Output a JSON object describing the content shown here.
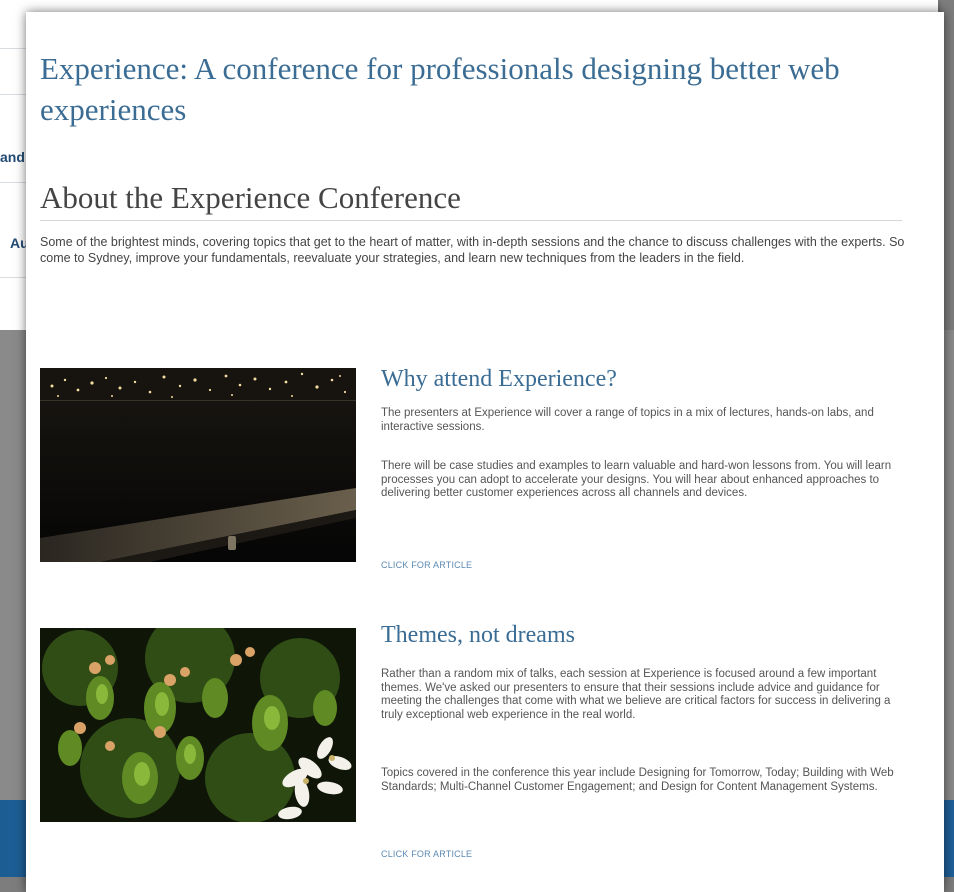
{
  "background": {
    "text_and": "and",
    "text_au": "Au"
  },
  "page": {
    "title": "Experience: A conference for professionals designing better web experiences",
    "section_title": "About the Experience Conference",
    "intro": "Some of the brightest minds, covering topics that get to the heart of matter, with in-depth sessions and the chance to discuss challenges with the experts. So come to Sydney, improve your fundamentals, reevaluate your strategies, and learn new techniques from the leaders in the field."
  },
  "cards": [
    {
      "title": "Why attend Experience?",
      "paragraphs": [
        "The presenters at Experience will cover a range of topics in a mix of lectures, hands-on labs, and interactive sessions.",
        "There will be case studies and examples to learn valuable and hard-won lessons from. You will learn processes you can adopt to accelerate your designs. You will hear about enhanced approaches to delivering better customer experiences across all channels and devices."
      ],
      "link": "CLICK FOR ARTICLE"
    },
    {
      "title": "Themes, not dreams",
      "paragraphs": [
        "Rather than a random mix of talks, each session at Experience is focused around a few important themes. We've asked our presenters to ensure that their sessions include advice and guidance for meeting the challenges that come with what we believe are critical factors for success in delivering a truly exceptional web experience in the real world.",
        "Topics covered in the conference this year include Designing for Tomorrow, Today; Building with Web Standards; Multi-Channel Customer Engagement; and Design for Content Management Systems."
      ],
      "link": "CLICK FOR ARTICLE"
    }
  ],
  "colors": {
    "heading_blue": "#3a6c94",
    "section_gray": "#444444",
    "link_blue": "#5b8ab3",
    "band_blue": "#1f5f98"
  }
}
